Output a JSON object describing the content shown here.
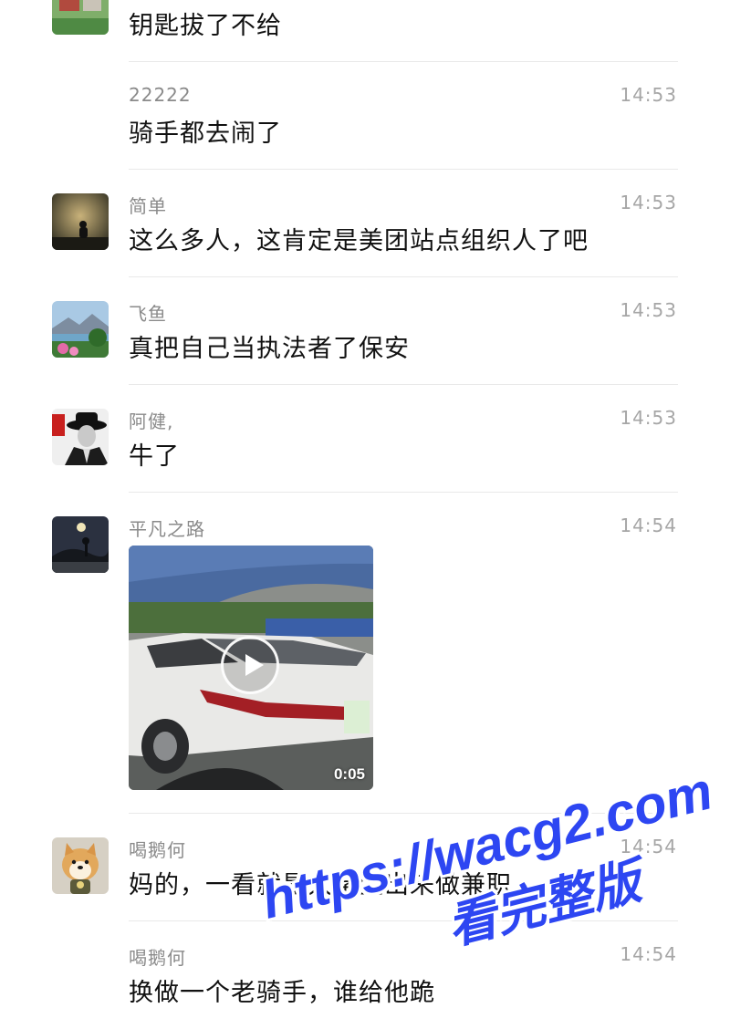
{
  "messages": [
    {
      "name": "",
      "time": "",
      "text": "钥匙拔了不给",
      "avatar": "campus-photo"
    },
    {
      "name": "22222",
      "time": "14:53",
      "text": "骑手都去闹了",
      "avatar": ""
    },
    {
      "name": "简单",
      "time": "14:53",
      "text": "这么多人，这肯定是美团站点组织人了吧",
      "avatar": "silhouette-sunset"
    },
    {
      "name": "飞鱼",
      "time": "14:53",
      "text": "真把自己当执法者了保安",
      "avatar": "lake-flowers"
    },
    {
      "name": "阿健,",
      "time": "14:53",
      "text": "牛了",
      "avatar": "man-in-hat"
    },
    {
      "name": "平凡之路",
      "time": "14:54",
      "text": "",
      "avatar": "night-road",
      "video_duration": "0:05"
    },
    {
      "name": "喝鹅何",
      "time": "14:54",
      "text": "妈的，一看就是大学生出来做兼职",
      "avatar": "shiba-dog"
    },
    {
      "name": "喝鹅何",
      "time": "14:54",
      "text": "换做一个老骑手，谁给他跪",
      "avatar": ""
    }
  ],
  "watermark": {
    "line1": "https://wacg2.com",
    "line2": "看完整版"
  },
  "colors": {
    "name": "#8a8a8a",
    "time": "#a6a6a6",
    "text": "#111111",
    "divider": "#e9e9e9",
    "watermark": "#2d46f2"
  }
}
